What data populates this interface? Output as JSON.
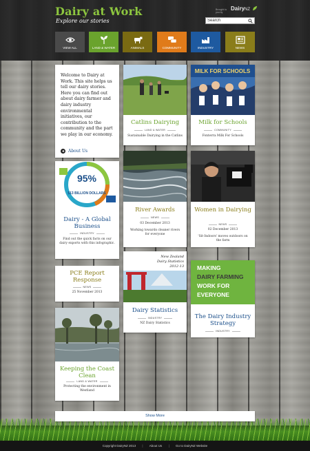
{
  "header": {
    "title": "Dairy at Work",
    "subtitle": "Explore our stories",
    "brand_small": "Brought to you by",
    "brand_logo": "Dairy",
    "brand_logo_suffix": "NZ",
    "search": {
      "value": "Search"
    }
  },
  "nav": [
    {
      "label": "View All",
      "icon": "eye-icon",
      "color": "#4a4a4a"
    },
    {
      "label": "Land & Water",
      "icon": "sprout-icon",
      "color": "#6aa32d"
    },
    {
      "label": "Animals",
      "icon": "cow-icon",
      "color": "#7a6a12"
    },
    {
      "label": "Community",
      "icon": "chat-icon",
      "color": "#e07b1a"
    },
    {
      "label": "Industry",
      "icon": "factory-icon",
      "color": "#1e5aa0"
    },
    {
      "label": "News",
      "icon": "newspaper-icon",
      "color": "#8a7d1a"
    }
  ],
  "intro": {
    "text": "Welcome to Dairy at Work. This site helps us tell our dairy stories. Here you can find out about dairy farmer and dairy industry environmental initiatives, our contribution to the community and the part we play in our economy.",
    "link": "About Us"
  },
  "cards": {
    "catlins": {
      "title": "Catlins Dairying",
      "category": "Land & Water",
      "desc": "Sustainable Dairying in the Catlins"
    },
    "milk": {
      "title": "Milk for Schools",
      "category": "Community",
      "desc": "Fonterra Milk For Schools",
      "image_text": "MILK FOR SCHOOLS"
    },
    "global": {
      "title": "Dairy - A Global Business",
      "category": "Industry",
      "desc": "Find out the quick facts on our dairy exports with this infographic.",
      "infographic_percent": "95%",
      "infographic_value": "$13 BILLION DOLLARS"
    },
    "river": {
      "title": "River Awards",
      "category": "News",
      "date": "03 December 2013",
      "desc": "Working towards cleaner rivers for everyone"
    },
    "women": {
      "title": "Women in Dairying",
      "category": "News",
      "date": "02 December 2013",
      "desc": "'Sit-Indoors' moves outdoors on the farm"
    },
    "pce": {
      "title": "PCE Report Response",
      "category": "News",
      "date": "25 November 2013"
    },
    "stats": {
      "title": "Dairy Statistics",
      "category": "Industry",
      "desc": "NZ Dairy Statistics",
      "image_text_1": "New Zealand",
      "image_text_2": "Dairy Statistics",
      "image_text_3": "2012-13"
    },
    "strategy": {
      "title": "The Dairy Industry Strategy",
      "category": "Industry",
      "banner_line1": "MAKING",
      "banner_line2": "DAIRY FARMING",
      "banner_line3": "WORK FOR",
      "banner_line4": "EVERYONE"
    },
    "coast": {
      "title": "Keeping the Coast Clean",
      "category": "Land & Water",
      "desc": "Protecting the environment in Westland"
    }
  },
  "show_more": "Show More",
  "footer": {
    "copyright": "Copyright DairyNZ 2013",
    "about": "About Us",
    "website": "Go to DairyNZ Website"
  }
}
